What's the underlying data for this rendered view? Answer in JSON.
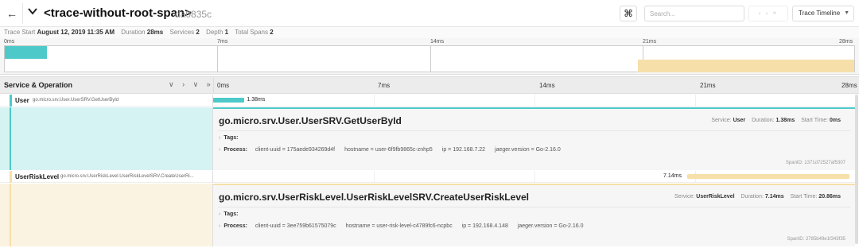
{
  "header": {
    "back_icon": "arrow-left-icon",
    "collapse_icon": "chevron-down-icon",
    "title": "<trace-without-root-span>",
    "trace_id": "da0835c",
    "shortcut_icon": "⌘",
    "search_placeholder": "Search...",
    "nav_buttons": "‹ › ×",
    "view_label": "Trace Timeline"
  },
  "meta": {
    "trace_start_label": "Trace Start",
    "trace_start_value": "August 12, 2019 11:35 AM",
    "duration_label": "Duration",
    "duration_value": "28ms",
    "services_label": "Services",
    "services_value": "2",
    "depth_label": "Depth",
    "depth_value": "1",
    "total_spans_label": "Total Spans",
    "total_spans_value": "2"
  },
  "minimap": {
    "ticks": [
      "0ms",
      "7ms",
      "14ms",
      "21ms",
      "28ms"
    ]
  },
  "ruler": {
    "label": "Service & Operation",
    "controls": "∨ › ∨ »",
    "ticks": [
      "0ms",
      "7ms",
      "14ms",
      "21ms",
      "28ms"
    ]
  },
  "colors": {
    "user": "#4ec9c9",
    "user_bg": "#d6f3f3",
    "risk": "#f7dfaa",
    "risk_bg": "#fbf3e1"
  },
  "spans": [
    {
      "service": "User",
      "operation": "go.micro.srv.User.UserSRV.GetUserById",
      "duration_label": "1.38ms",
      "start_ms": 0,
      "duration_ms": 1.38,
      "detail": {
        "op_full": "go.micro.srv.User.UserSRV.GetUserById",
        "service_label": "Service:",
        "service_value": "User",
        "duration_label": "Duration:",
        "duration_value": "1.38ms",
        "start_label": "Start Time:",
        "start_value": "0ms",
        "tags_label": "Tags:",
        "process_label": "Process:",
        "process": [
          {
            "k": "client-uuid",
            "v": "175aede934269d4f"
          },
          {
            "k": "hostname",
            "v": "user-6f9fb9865c-znhp5"
          },
          {
            "k": "ip",
            "v": "192.168.7.22"
          },
          {
            "k": "jaeger.version",
            "v": "Go-2.16.0"
          }
        ],
        "span_id_label": "SpanID:",
        "span_id": "1371d72527af5307"
      }
    },
    {
      "service": "UserRiskLevel",
      "operation": "go.micro.srv.UserRiskLevel.UserRiskLevelSRV.CreateUserRi...",
      "duration_label": "7.14ms",
      "start_ms": 20.86,
      "duration_ms": 7.14,
      "detail": {
        "op_full": "go.micro.srv.UserRiskLevel.UserRiskLevelSRV.CreateUserRiskLevel",
        "service_label": "Service:",
        "service_value": "UserRiskLevel",
        "duration_label": "Duration:",
        "duration_value": "7.14ms",
        "start_label": "Start Time:",
        "start_value": "20.86ms",
        "tags_label": "Tags:",
        "process_label": "Process:",
        "process": [
          {
            "k": "client-uuid",
            "v": "3ee759b61575079c"
          },
          {
            "k": "hostname",
            "v": "user-risk-level-c4789fc6-ncpbc"
          },
          {
            "k": "ip",
            "v": "192.168.4.148"
          },
          {
            "k": "jaeger.version",
            "v": "Go-2.16.0"
          }
        ],
        "span_id_label": "SpanID:",
        "span_id": "2785b49e1f343f35"
      }
    }
  ]
}
